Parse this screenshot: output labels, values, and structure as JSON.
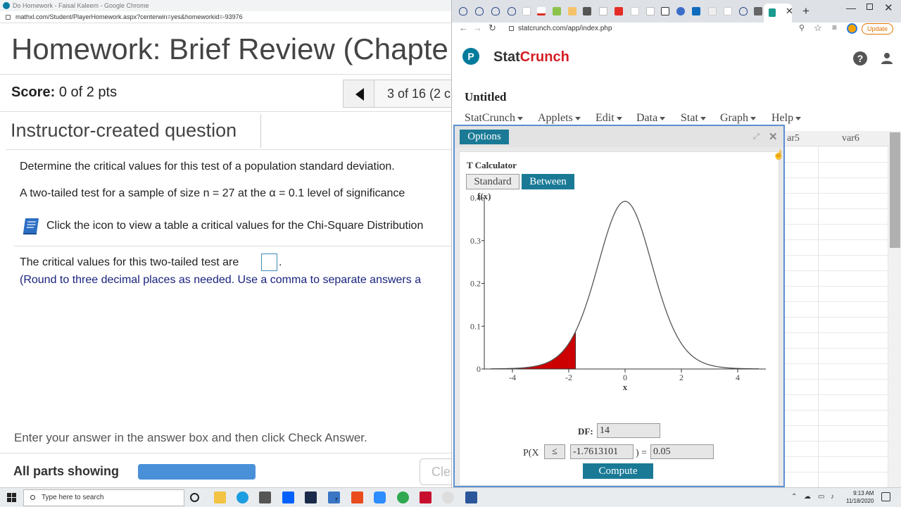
{
  "left_window": {
    "title": "Do Homework - Faisal Kaleem - Google Chrome",
    "url": "mathxl.com/Student/PlayerHomework.aspx?centerwin=yes&homeworkid=-93976",
    "homework_title": "Homework: Brief Review (Chapte",
    "score_label": "Score:",
    "score_value": "0 of 2 pts",
    "nav_text": "3 of 16 (2 c",
    "instructor_question": "Instructor-created question",
    "question_line1": "Determine the critical values for this test of a population standard deviation.",
    "question_line2": "A two-tailed test for a sample of size n = 27 at the α = 0.1 level of significance",
    "table_link": "Click the icon to view a table a critical values for the Chi-Square Distribution",
    "answer_prompt": "The critical values for this two-tailed test are",
    "answer_suffix": ".",
    "round_note": "(Round to three decimal places as needed. Use a comma to separate answers a",
    "enter_instruction": "Enter your answer in the answer box and then click Check Answer.",
    "parts_label": "All parts showing",
    "progress": 1.0,
    "clear_label": "Cle"
  },
  "right_window": {
    "url": "statcrunch.com/app/index.php",
    "update_label": "Update",
    "brand_stat": "Stat",
    "brand_crunch": "Crunch",
    "pearson_letter": "P",
    "help_glyph": "?",
    "doc_title": "Untitled",
    "menus": [
      "StatCrunch",
      "Applets",
      "Edit",
      "Data",
      "Stat",
      "Graph",
      "Help"
    ],
    "grid_columns": [
      "ar5",
      "var6"
    ],
    "colors": {
      "teal": "#1a7a96",
      "crunch_red": "#d41e26",
      "shade_red": "#cc0000"
    }
  },
  "dialog": {
    "options_label": "Options",
    "calc_title": "T Calculator",
    "tab_standard": "Standard",
    "tab_between": "Between",
    "df_label": "DF:",
    "df_value": "14",
    "p_open": "P(X",
    "operator": "≤",
    "x_value": "-1.7613101",
    "p_close": ") =",
    "p_value": "0.05",
    "compute_label": "Compute"
  },
  "chart_data": {
    "type": "area",
    "distribution": "t",
    "df": 14,
    "ylabel": "f(x)",
    "xlabel": "x",
    "xlim": [
      -5.0,
      5.0
    ],
    "ylim": [
      0,
      0.4
    ],
    "x_ticks": [
      -4,
      -2,
      0,
      2,
      4
    ],
    "y_ticks": [
      0,
      0.1,
      0.2,
      0.3,
      0.4
    ],
    "shaded_region": {
      "from": -5.0,
      "to": -1.7613101,
      "color": "#cc0000"
    },
    "grid": false
  },
  "taskbar": {
    "search_placeholder": "Type here to search",
    "time": "9:13 AM",
    "date": "11/18/2020",
    "mail_badge": "7"
  }
}
